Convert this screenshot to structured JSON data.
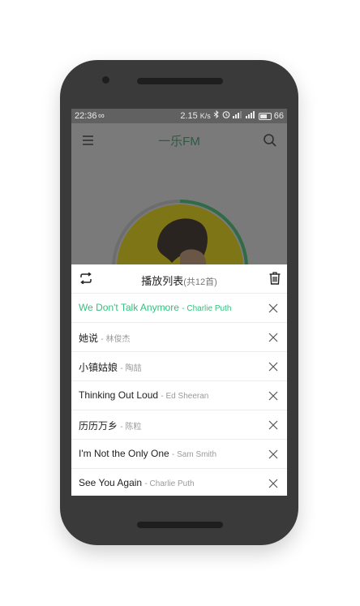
{
  "status_bar": {
    "time": "22:36",
    "speed": "2.15",
    "speed_unit": "K/s",
    "battery": "66",
    "icons": [
      "infinity-icon",
      "bluetooth-icon",
      "alarm-icon",
      "signal-icon",
      "signal-icon",
      "battery-icon"
    ]
  },
  "app_bar": {
    "title": "一乐FM",
    "icons": [
      "menu-icon",
      "search-icon"
    ]
  },
  "playlist": {
    "title": "播放列表",
    "count_label": "(共12首)",
    "icons": [
      "repeat-icon",
      "trash-icon",
      "close-icon"
    ],
    "songs": [
      {
        "title": "We Don't Talk Anymore",
        "artist": "- Charlie Puth",
        "active": true
      },
      {
        "title": "她说",
        "artist": "- 林俊杰",
        "active": false
      },
      {
        "title": "小镇姑娘",
        "artist": "- 陶喆",
        "active": false
      },
      {
        "title": "Thinking Out Loud",
        "artist": "- Ed Sheeran",
        "active": false
      },
      {
        "title": "历历万乡",
        "artist": "- 陈粒",
        "active": false
      },
      {
        "title": "I'm Not the Only One",
        "artist": "- Sam Smith",
        "active": false
      },
      {
        "title": "See You Again",
        "artist": "- Charlie Puth",
        "active": false
      }
    ]
  },
  "colors": {
    "accent": "#31c27c",
    "overlay": "#7a7a7a",
    "phone_body": "#3a3a3a"
  }
}
